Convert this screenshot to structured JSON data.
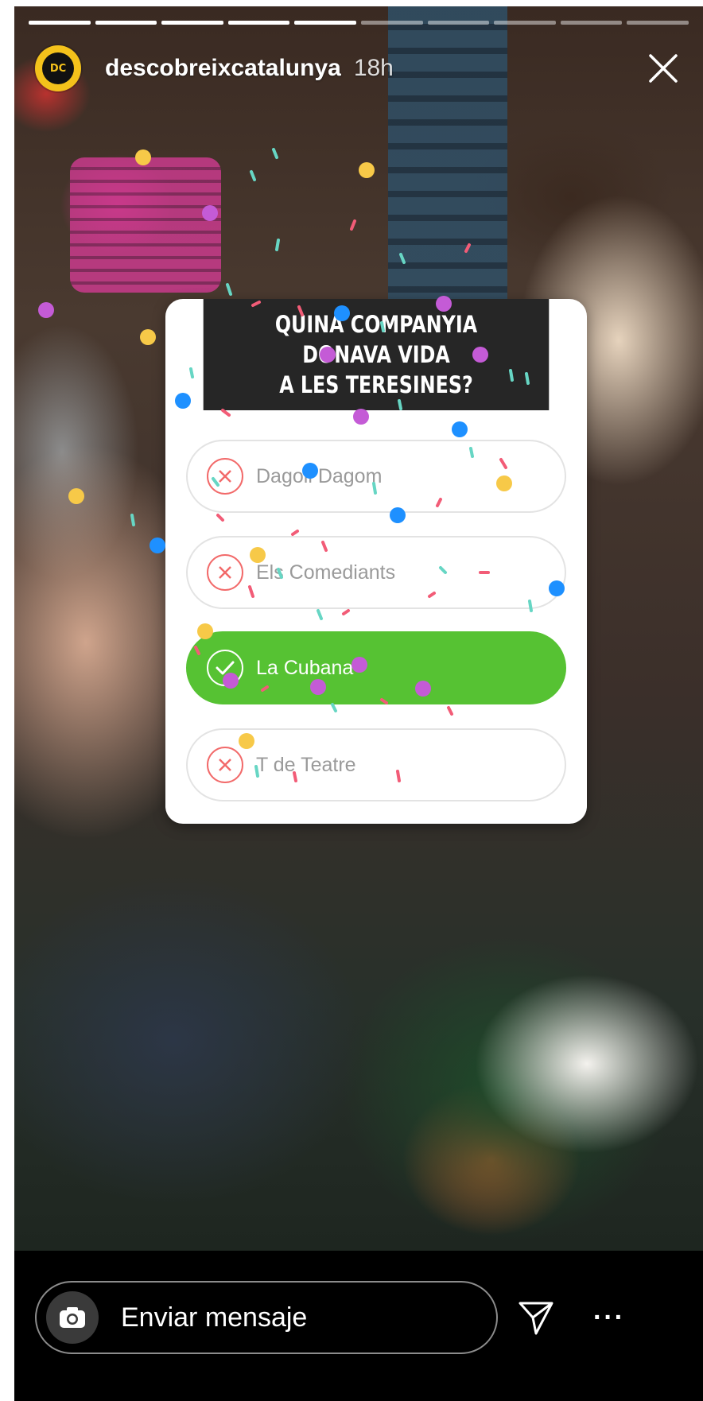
{
  "story": {
    "progress_segments": 10,
    "progress_done": 5,
    "username": "descobreixcatalunya",
    "time_ago": "18h",
    "avatar_text": "DC",
    "avatar_icon": "descobreix-catalunya-logo",
    "close_icon": "close-icon"
  },
  "quiz": {
    "question_line1": "QUINA COMPANYIA DONAVA VIDA",
    "question_line2": "A LES TERESINES?",
    "options": [
      {
        "label": "Dagoll Dagom",
        "state": "wrong"
      },
      {
        "label": "Els Comediants",
        "state": "wrong"
      },
      {
        "label": "La Cubana",
        "state": "correct"
      },
      {
        "label": "T de Teatre",
        "state": "wrong"
      }
    ],
    "colors": {
      "correct": "#56c233",
      "wrong": "#f26a6a",
      "header": "#262626"
    }
  },
  "reply_bar": {
    "placeholder": "Enviar mensaje",
    "camera_icon": "camera-icon",
    "send_icon": "send-icon",
    "more_label": "···"
  }
}
